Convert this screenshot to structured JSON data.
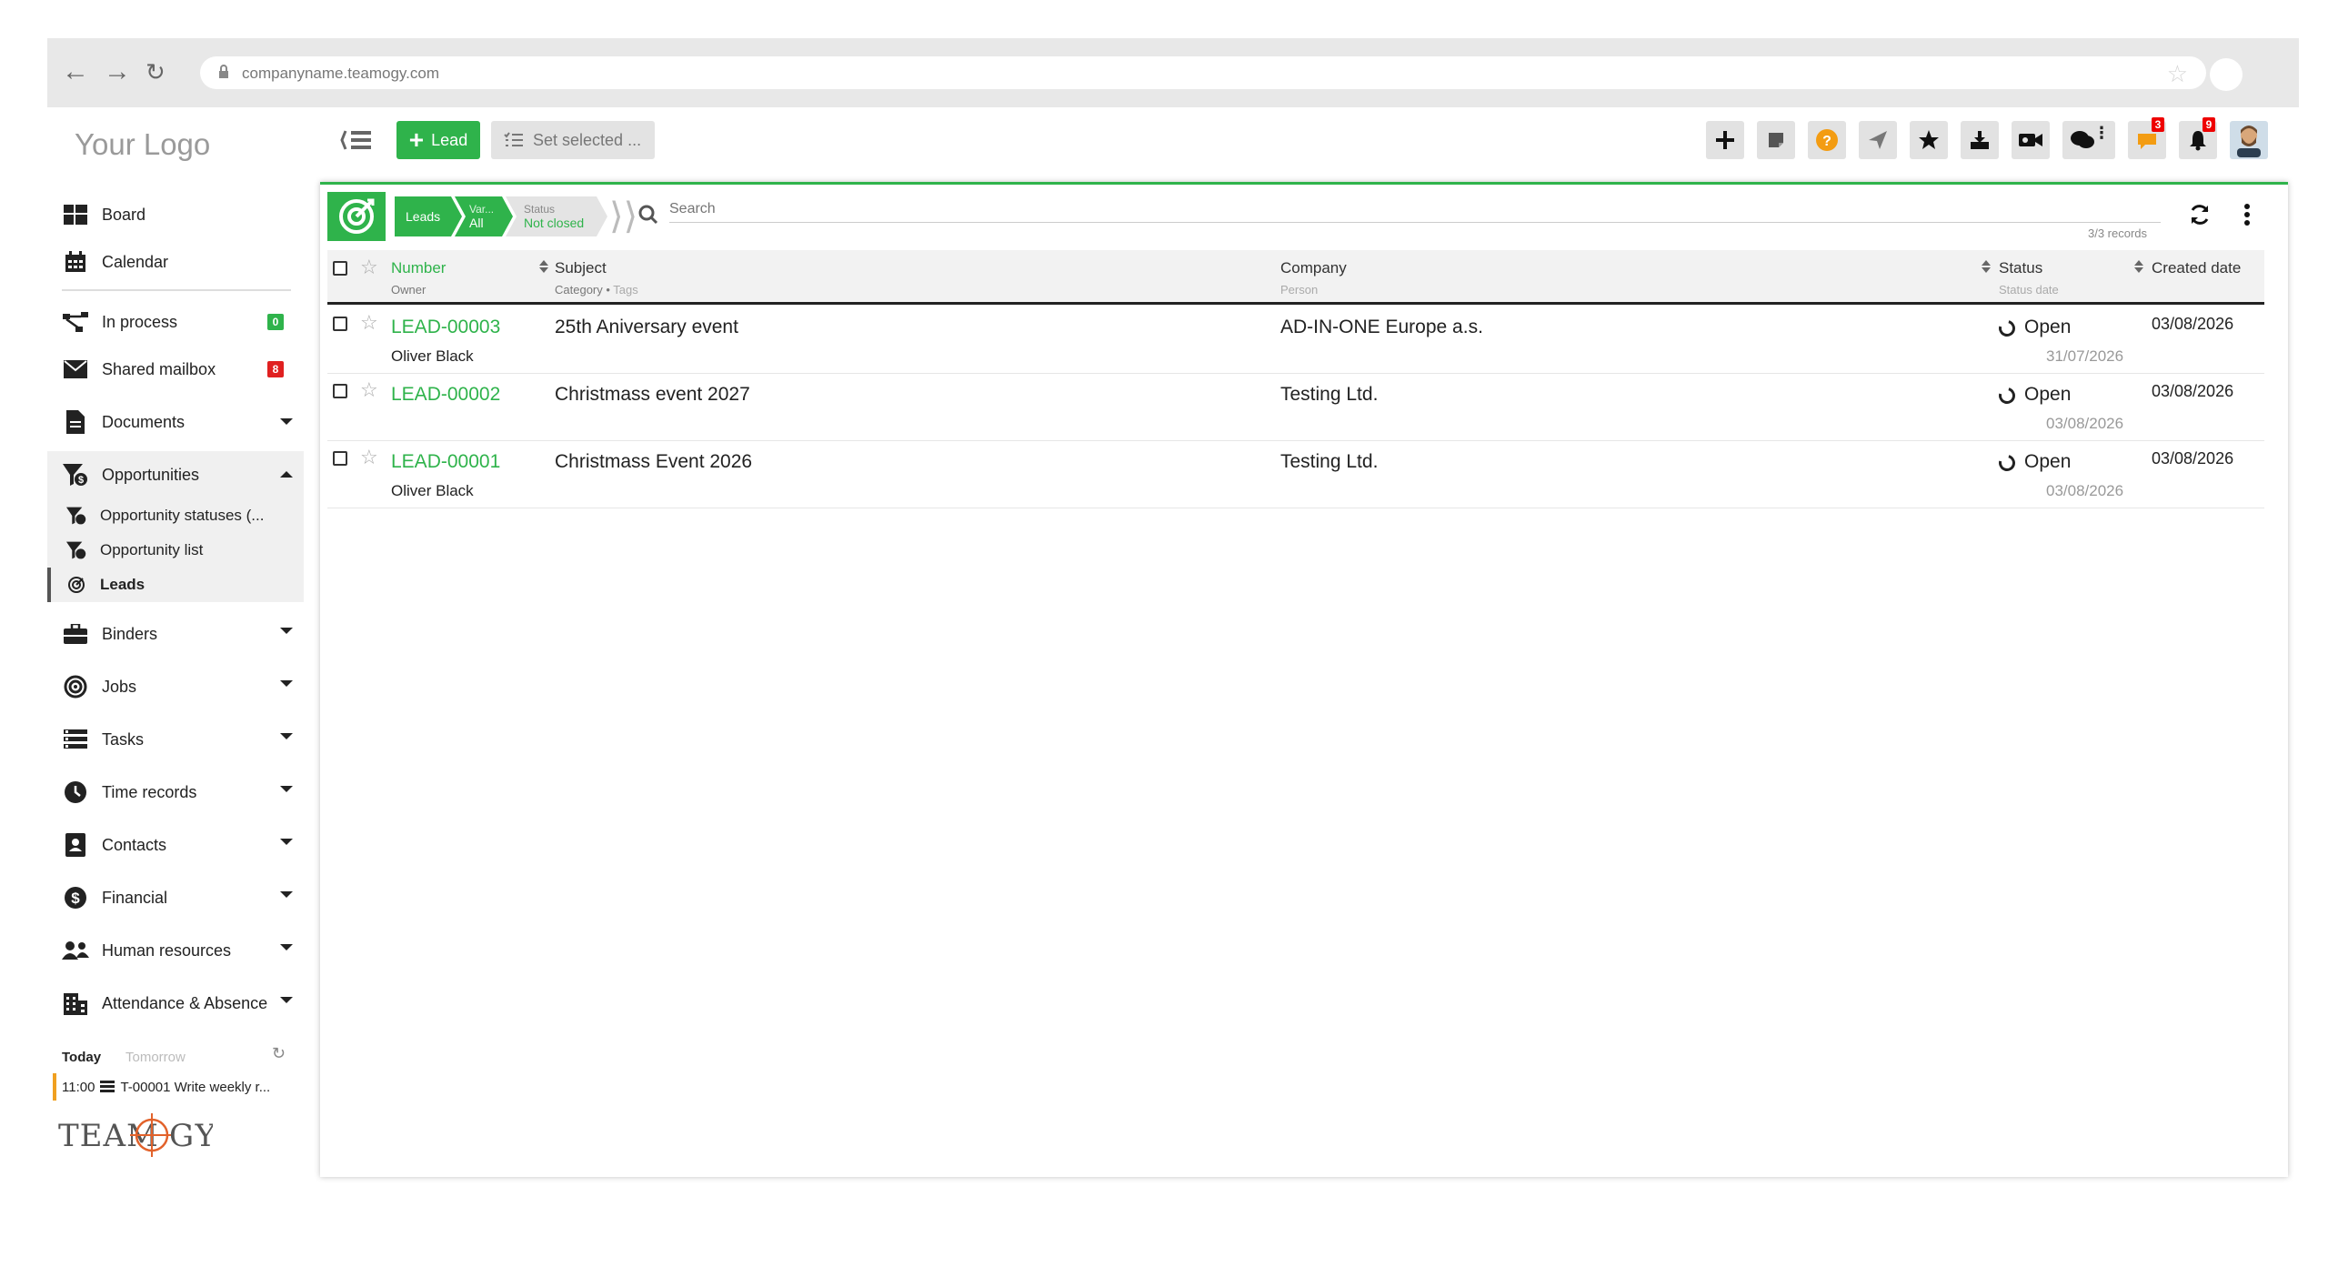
{
  "browser": {
    "url": "companyname.teamogy.com"
  },
  "app": {
    "logo_text": "Your Logo",
    "brand_logo_text": "TEAMOGY",
    "lead_button": "Lead",
    "set_selected_button": "Set selected ...",
    "toolbar_badges": {
      "messages": "3",
      "notifications": "9"
    }
  },
  "sidebar": {
    "items": [
      {
        "label": "Board",
        "icon": "board-icon"
      },
      {
        "label": "Calendar",
        "icon": "calendar-icon"
      },
      {
        "label": "In process",
        "icon": "process-icon",
        "badge": "0",
        "badge_color": "#2fb34b"
      },
      {
        "label": "Shared mailbox",
        "icon": "mail-icon",
        "badge": "8",
        "badge_color": "#e02020"
      },
      {
        "label": "Documents",
        "icon": "document-icon"
      },
      {
        "label": "Opportunities",
        "icon": "opportunity-icon"
      },
      {
        "label": "Binders",
        "icon": "briefcase-icon"
      },
      {
        "label": "Jobs",
        "icon": "target-icon"
      },
      {
        "label": "Tasks",
        "icon": "tasks-icon"
      },
      {
        "label": "Time records",
        "icon": "clock-icon"
      },
      {
        "label": "Contacts",
        "icon": "contact-icon"
      },
      {
        "label": "Financial",
        "icon": "dollar-icon"
      },
      {
        "label": "Human resources",
        "icon": "people-icon"
      },
      {
        "label": "Attendance & Absence",
        "icon": "building-icon"
      }
    ],
    "subitems": [
      {
        "label": "Opportunity statuses (..."
      },
      {
        "label": "Opportunity list"
      },
      {
        "label": "Leads"
      }
    ],
    "today_tab": "Today",
    "tomorrow_tab": "Tomorrow",
    "agenda": {
      "time": "11:00",
      "text": "T-00001 Write weekly r..."
    }
  },
  "filter": {
    "crumb1": "Leads",
    "crumb2_top": "Var...",
    "crumb2_bottom": "All",
    "crumb3_top": "Status",
    "crumb3_bottom": "Not closed",
    "search_placeholder": "Search",
    "records": "3/3 records"
  },
  "table": {
    "headers": {
      "number": "Number",
      "number_sub": "Owner",
      "subject": "Subject",
      "subject_sub": "Category",
      "subject_sub2": "Tags",
      "company": "Company",
      "company_sub": "Person",
      "status": "Status",
      "status_sub": "Status date",
      "created": "Created date"
    },
    "rows": [
      {
        "number": "LEAD-00003",
        "owner": "Oliver Black",
        "subject": "25th Aniversary event",
        "company": "AD-IN-ONE Europe a.s.",
        "status": "Open",
        "status_date": "31/07/2026",
        "created": "03/08/2026"
      },
      {
        "number": "LEAD-00002",
        "owner": "",
        "subject": "Christmass event 2027",
        "company": "Testing Ltd.",
        "status": "Open",
        "status_date": "03/08/2026",
        "created": "03/08/2026"
      },
      {
        "number": "LEAD-00001",
        "owner": "Oliver Black",
        "subject": "Christmass Event 2026",
        "company": "Testing Ltd.",
        "status": "Open",
        "status_date": "03/08/2026",
        "created": "03/08/2026"
      }
    ]
  },
  "colors": {
    "accent": "#2fb34b",
    "badge_red": "#e02020"
  }
}
